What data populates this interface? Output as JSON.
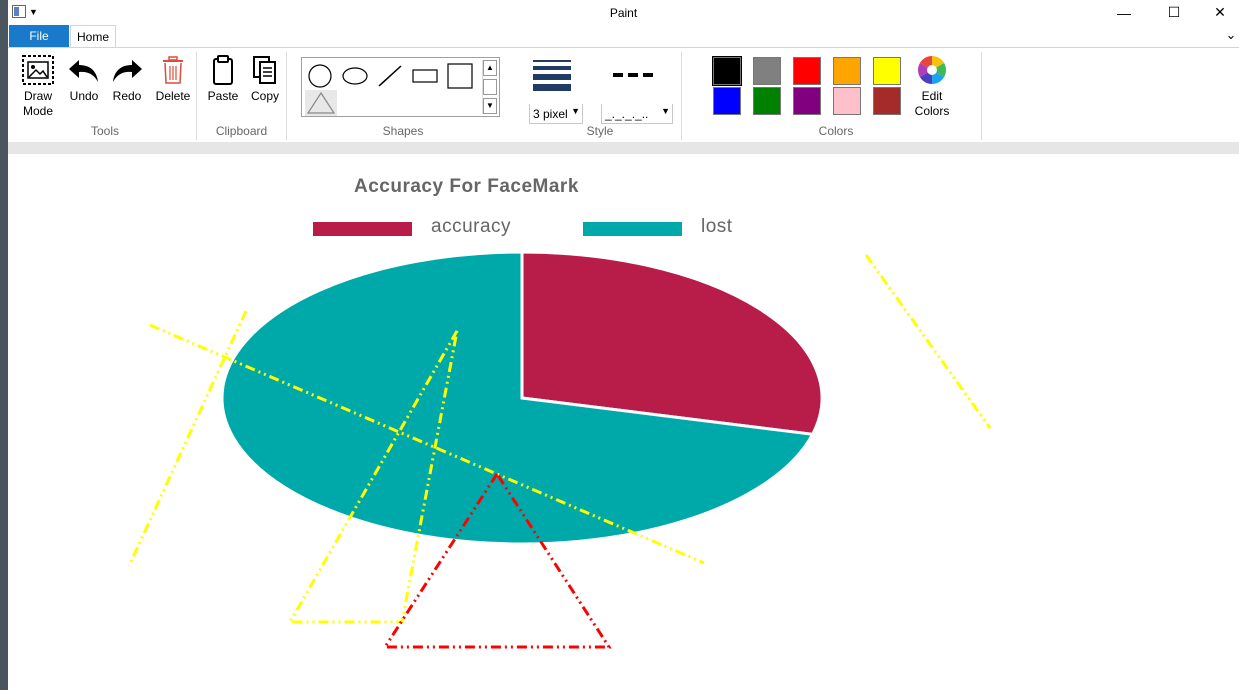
{
  "window": {
    "title": "Paint",
    "minimize_glyph": "—",
    "maximize_glyph": "☐",
    "close_glyph": "✕",
    "sysmenu_arrow": "▼"
  },
  "tabs": {
    "file": "File",
    "home": "Home",
    "collapse_glyph": "⌄"
  },
  "ribbon": {
    "tools": {
      "label": "Tools",
      "draw_mode": "Draw Mode",
      "undo": "Undo",
      "redo": "Redo",
      "delete": "Delete"
    },
    "clipboard": {
      "label": "Clipboard",
      "paste": "Paste",
      "copy": "Copy"
    },
    "shapes": {
      "label": "Shapes",
      "items": [
        "circle",
        "ellipse",
        "line",
        "rectangle",
        "square",
        "triangle"
      ]
    },
    "style": {
      "label": "Style",
      "thickness": "3 pixel",
      "dash": "_._._._.."
    },
    "colors": {
      "label": "Colors",
      "edit": "Edit Colors",
      "palette": [
        "#000000",
        "#808080",
        "#ff0000",
        "#ffa500",
        "#ffff00",
        "#0000ff",
        "#008000",
        "#800080",
        "#ffc0cb",
        "#a52a2a"
      ]
    }
  },
  "canvas_image": {
    "chart_data": {
      "type": "pie",
      "title": "Accuracy For FaceMark",
      "labels": [
        "accuracy",
        "lost"
      ],
      "values": [
        29,
        71
      ],
      "colors": [
        "#b81d4a",
        "#00a9a9"
      ],
      "legend": "top"
    }
  },
  "drawings": {
    "stroke_colors": [
      "#ffff00",
      "#ff0000"
    ],
    "style": "dash-dot-dot"
  }
}
